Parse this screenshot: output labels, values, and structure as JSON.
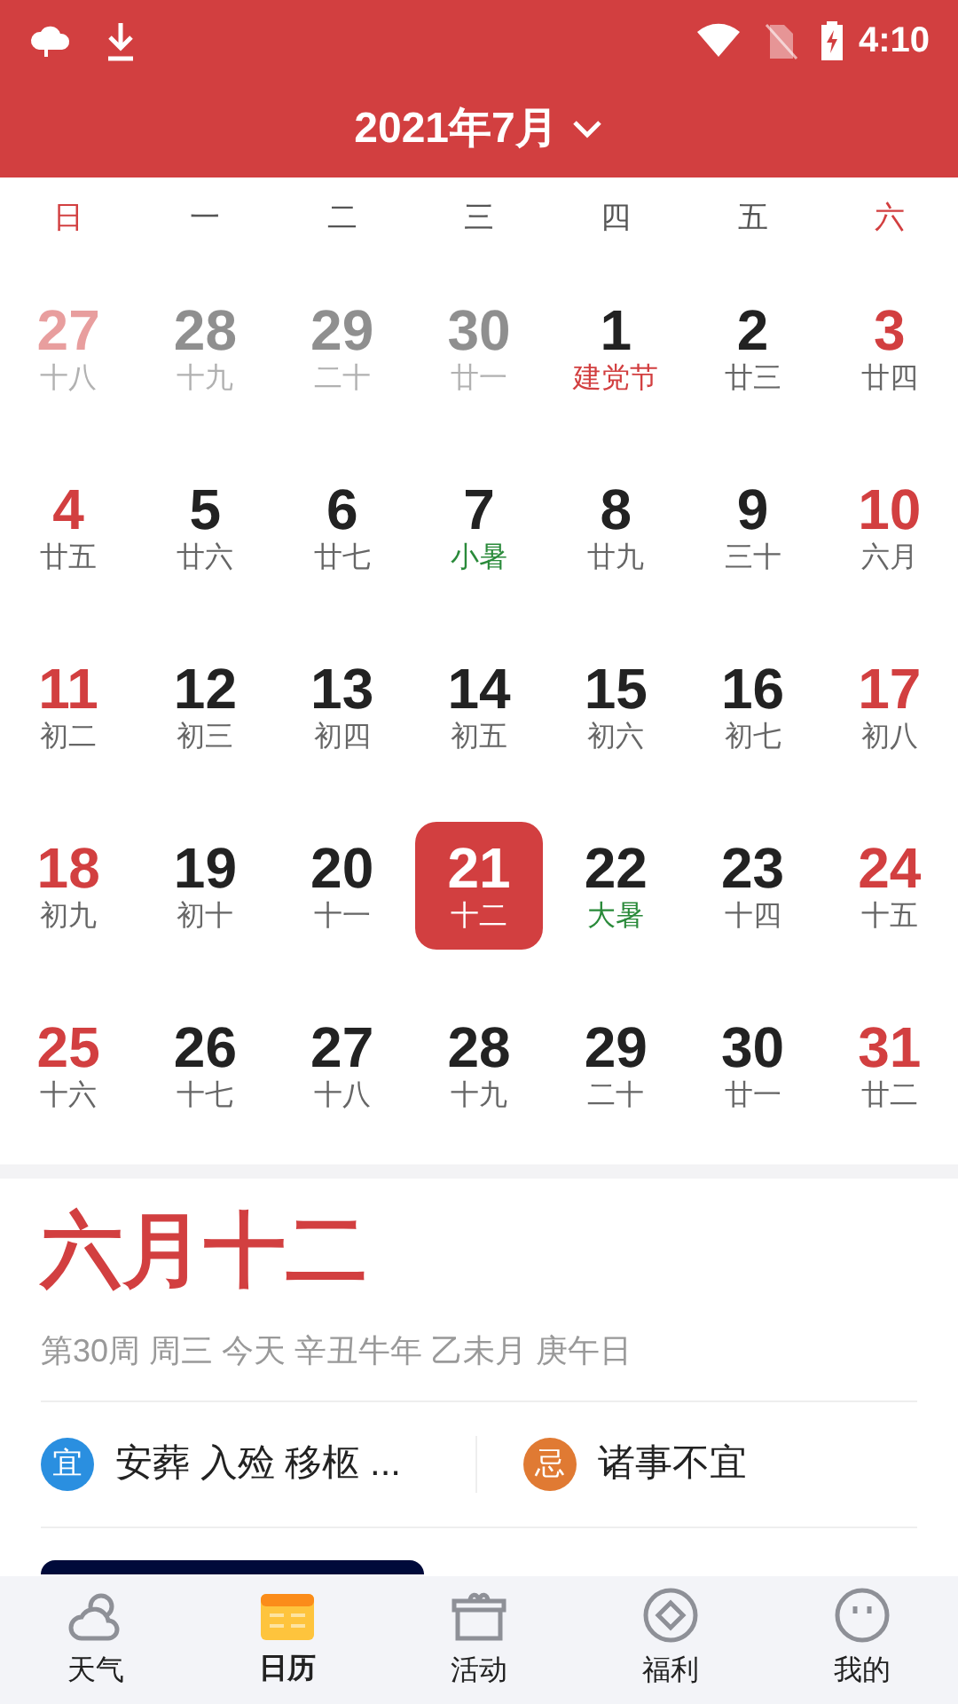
{
  "status_bar": {
    "time": "4:10"
  },
  "header": {
    "title": "2021年7月"
  },
  "weekdays": [
    {
      "label": "日",
      "weekend": true
    },
    {
      "label": "一",
      "weekend": false
    },
    {
      "label": "二",
      "weekend": false
    },
    {
      "label": "三",
      "weekend": false
    },
    {
      "label": "四",
      "weekend": false
    },
    {
      "label": "五",
      "weekend": false
    },
    {
      "label": "六",
      "weekend": true
    }
  ],
  "days": [
    {
      "day": "27",
      "lunar": "十八",
      "in_month": false,
      "weekend": true,
      "kind": "plain",
      "selected": false
    },
    {
      "day": "28",
      "lunar": "十九",
      "in_month": false,
      "weekend": false,
      "kind": "plain",
      "selected": false
    },
    {
      "day": "29",
      "lunar": "二十",
      "in_month": false,
      "weekend": false,
      "kind": "plain",
      "selected": false
    },
    {
      "day": "30",
      "lunar": "廿一",
      "in_month": false,
      "weekend": false,
      "kind": "plain",
      "selected": false
    },
    {
      "day": "1",
      "lunar": "建党节",
      "in_month": true,
      "weekend": false,
      "kind": "festival",
      "selected": false
    },
    {
      "day": "2",
      "lunar": "廿三",
      "in_month": true,
      "weekend": false,
      "kind": "plain",
      "selected": false
    },
    {
      "day": "3",
      "lunar": "廿四",
      "in_month": true,
      "weekend": true,
      "kind": "plain",
      "selected": false
    },
    {
      "day": "4",
      "lunar": "廿五",
      "in_month": true,
      "weekend": true,
      "kind": "plain",
      "selected": false
    },
    {
      "day": "5",
      "lunar": "廿六",
      "in_month": true,
      "weekend": false,
      "kind": "plain",
      "selected": false
    },
    {
      "day": "6",
      "lunar": "廿七",
      "in_month": true,
      "weekend": false,
      "kind": "plain",
      "selected": false
    },
    {
      "day": "7",
      "lunar": "小暑",
      "in_month": true,
      "weekend": false,
      "kind": "term",
      "selected": false
    },
    {
      "day": "8",
      "lunar": "廿九",
      "in_month": true,
      "weekend": false,
      "kind": "plain",
      "selected": false
    },
    {
      "day": "9",
      "lunar": "三十",
      "in_month": true,
      "weekend": false,
      "kind": "plain",
      "selected": false
    },
    {
      "day": "10",
      "lunar": "六月",
      "in_month": true,
      "weekend": true,
      "kind": "plain",
      "selected": false
    },
    {
      "day": "11",
      "lunar": "初二",
      "in_month": true,
      "weekend": true,
      "kind": "plain",
      "selected": false
    },
    {
      "day": "12",
      "lunar": "初三",
      "in_month": true,
      "weekend": false,
      "kind": "plain",
      "selected": false
    },
    {
      "day": "13",
      "lunar": "初四",
      "in_month": true,
      "weekend": false,
      "kind": "plain",
      "selected": false
    },
    {
      "day": "14",
      "lunar": "初五",
      "in_month": true,
      "weekend": false,
      "kind": "plain",
      "selected": false
    },
    {
      "day": "15",
      "lunar": "初六",
      "in_month": true,
      "weekend": false,
      "kind": "plain",
      "selected": false
    },
    {
      "day": "16",
      "lunar": "初七",
      "in_month": true,
      "weekend": false,
      "kind": "plain",
      "selected": false
    },
    {
      "day": "17",
      "lunar": "初八",
      "in_month": true,
      "weekend": true,
      "kind": "plain",
      "selected": false
    },
    {
      "day": "18",
      "lunar": "初九",
      "in_month": true,
      "weekend": true,
      "kind": "plain",
      "selected": false
    },
    {
      "day": "19",
      "lunar": "初十",
      "in_month": true,
      "weekend": false,
      "kind": "plain",
      "selected": false
    },
    {
      "day": "20",
      "lunar": "十一",
      "in_month": true,
      "weekend": false,
      "kind": "plain",
      "selected": false
    },
    {
      "day": "21",
      "lunar": "十二",
      "in_month": true,
      "weekend": false,
      "kind": "plain",
      "selected": true
    },
    {
      "day": "22",
      "lunar": "大暑",
      "in_month": true,
      "weekend": false,
      "kind": "term",
      "selected": false
    },
    {
      "day": "23",
      "lunar": "十四",
      "in_month": true,
      "weekend": false,
      "kind": "plain",
      "selected": false
    },
    {
      "day": "24",
      "lunar": "十五",
      "in_month": true,
      "weekend": true,
      "kind": "plain",
      "selected": false
    },
    {
      "day": "25",
      "lunar": "十六",
      "in_month": true,
      "weekend": true,
      "kind": "plain",
      "selected": false
    },
    {
      "day": "26",
      "lunar": "十七",
      "in_month": true,
      "weekend": false,
      "kind": "plain",
      "selected": false
    },
    {
      "day": "27",
      "lunar": "十八",
      "in_month": true,
      "weekend": false,
      "kind": "plain",
      "selected": false
    },
    {
      "day": "28",
      "lunar": "十九",
      "in_month": true,
      "weekend": false,
      "kind": "plain",
      "selected": false
    },
    {
      "day": "29",
      "lunar": "二十",
      "in_month": true,
      "weekend": false,
      "kind": "plain",
      "selected": false
    },
    {
      "day": "30",
      "lunar": "廿一",
      "in_month": true,
      "weekend": false,
      "kind": "plain",
      "selected": false
    },
    {
      "day": "31",
      "lunar": "廿二",
      "in_month": true,
      "weekend": true,
      "kind": "plain",
      "selected": false
    }
  ],
  "detail": {
    "lunar_date": "六月十二",
    "info": "第30周 周三 今天 辛丑牛年 乙未月 庚午日",
    "almanac": [
      {
        "kind": "yi",
        "badge": "宜",
        "text": "安葬 入殓 移柩 ..."
      },
      {
        "kind": "ji",
        "badge": "忌",
        "text": "诸事不宜"
      }
    ]
  },
  "tab_bar": [
    {
      "label": "天气",
      "selected": false
    },
    {
      "label": "日历",
      "selected": true
    },
    {
      "label": "活动",
      "selected": false
    },
    {
      "label": "福利",
      "selected": false
    },
    {
      "label": "我的",
      "selected": false
    }
  ]
}
